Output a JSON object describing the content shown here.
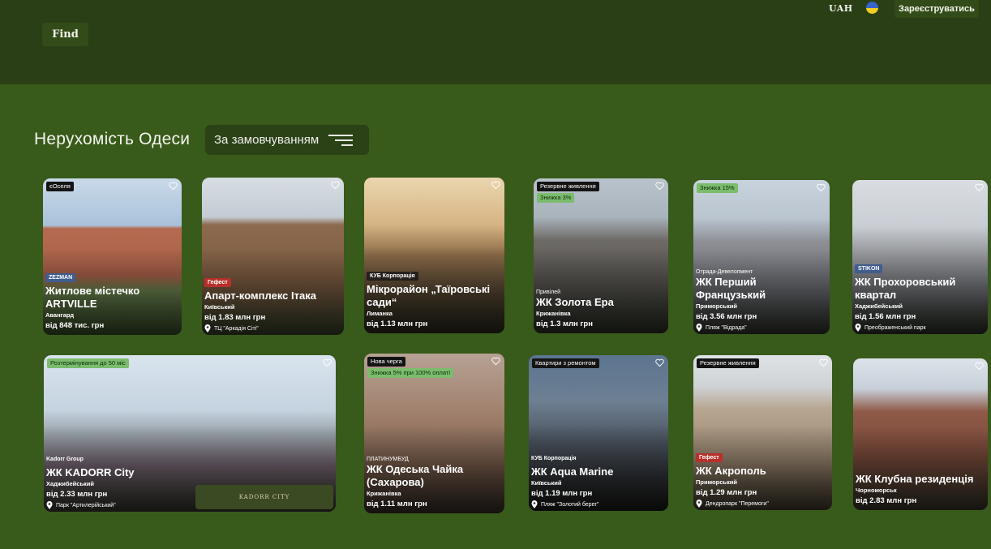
{
  "header": {
    "find_label": "Find",
    "currency": "UAH",
    "register_label": "Зареєструватись"
  },
  "main": {
    "title": "Нерухомість Одеси",
    "sort_label": "За замовчуванням"
  },
  "colors": {
    "page_bg": "#385a1a",
    "header_bg": "#2b3f16",
    "badge_green": "#7bbd6d"
  },
  "cards": [
    {
      "badges": [
        "єОселя"
      ],
      "developer": "ZEZMAN",
      "name": "Житлове містечко ARTVILLE",
      "district": "Авангард",
      "price": "від 848 тис. грн"
    },
    {
      "developer": "Гефест",
      "name": "Апарт-комплекс Ітака",
      "district": "Київський",
      "price": "від 1.83 млн грн",
      "place": "ТЦ \"Аркадія Сіті\""
    },
    {
      "developer": "КУБ Корпорація",
      "name": "Мікрорайон „Таїровські сади“",
      "district": "Лиманка",
      "price": "від 1.13 млн грн"
    },
    {
      "badges": [
        "Резервне живлення",
        "Знижка 3%"
      ],
      "developer": "Привілей",
      "name": "ЖК Золота Ера",
      "district": "Крижанівка",
      "price": "від 1.3 млн грн"
    },
    {
      "badges": [
        "Знижка 15%"
      ],
      "developer": "Отрада-Девелопмент",
      "name": "ЖК Перший Французький",
      "district": "Приморський",
      "price": "від 3.56 млн грн",
      "place": "Пляж \"Відрада\""
    },
    {
      "developer": "STIKON",
      "name": "ЖК Прохоровський квартал",
      "district": "Хаджибейський",
      "price": "від 1.56 млн грн",
      "place": "Преображенський парк"
    },
    {
      "badges": [
        "Розтермінування до 50 міс"
      ],
      "developer": "Kadorr Group",
      "name": "ЖК KADORR City",
      "district": "Хаджибейський",
      "price": "від 2.33 млн грн",
      "place": "Парк \"Артилерійський\"",
      "logo": "KADORR CITY"
    },
    {
      "badges": [
        "Нова черга",
        "Знижка 5% при 100% оплаті"
      ],
      "developer": "ПЛАТИНУМБУД",
      "name": "ЖК Одеська Чайка (Сахарова)",
      "district": "Крижанівка",
      "price": "від 1.11 млн грн"
    },
    {
      "badges": [
        "Квартири з ремонтом"
      ],
      "developer": "КУБ Корпорація",
      "name": "ЖК Aqua Marine",
      "district": "Київський",
      "price": "від 1.19 млн грн",
      "place": "Пляж \"Золотий берег\""
    },
    {
      "badges": [
        "Резервне живлення"
      ],
      "developer": "Гефест",
      "name": "ЖК Акрополь",
      "district": "Приморський",
      "price": "від 1.29 млн грн",
      "place": "Дендропарк \"Перемоги\""
    },
    {
      "name": "ЖК Клубна резиденція",
      "district": "Чорноморськ",
      "price": "від 2.83 млн грн"
    }
  ]
}
